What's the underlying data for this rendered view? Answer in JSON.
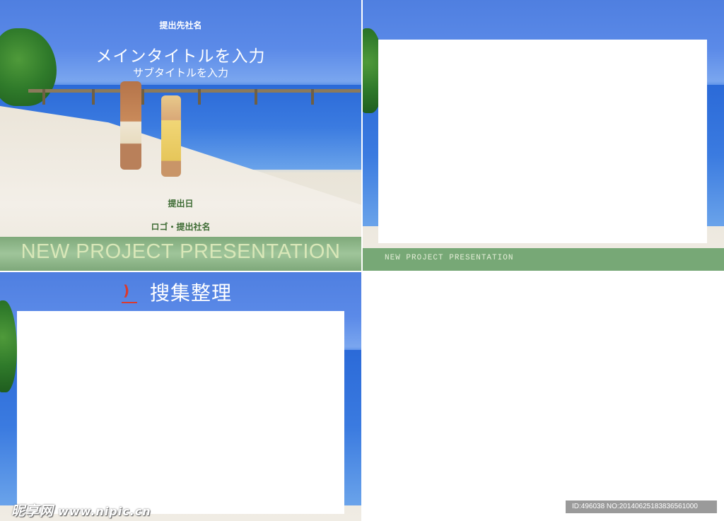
{
  "slide1": {
    "company_top": "提出先社名",
    "main_title": "メインタイトルを入力",
    "sub_title": "サブタイトルを入力",
    "date_label": "提出日",
    "logo_label": "ロゴ・提出社名",
    "banner_text": "NEW PROJECT PRESENTATION"
  },
  "slide2": {
    "banner_text": "NEW PROJECT PRESENTATION"
  },
  "slide3": {
    "bracket_glyph": ")",
    "title": "搜集整理"
  },
  "watermark": {
    "brand": "昵享网",
    "url": "www.nipic.cn"
  },
  "id_badge": "ID:496038 NO:20140625183836561000",
  "colors": {
    "band_green": "#77a876",
    "title_accent_red": "#d93b2f",
    "label_green": "#3d6b33"
  }
}
